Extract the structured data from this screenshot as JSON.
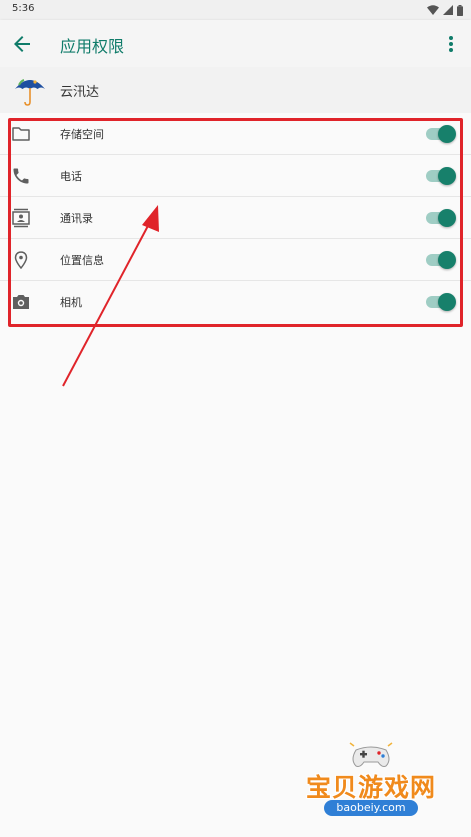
{
  "status_bar": {
    "time": "5:36"
  },
  "app_bar": {
    "title": "应用权限"
  },
  "app": {
    "name": "云汛达"
  },
  "permissions": [
    {
      "label": "存储空间",
      "icon": "folder-icon",
      "enabled": true
    },
    {
      "label": "电话",
      "icon": "phone-icon",
      "enabled": true
    },
    {
      "label": "通讯录",
      "icon": "contacts-icon",
      "enabled": true
    },
    {
      "label": "位置信息",
      "icon": "location-icon",
      "enabled": true
    },
    {
      "label": "相机",
      "icon": "camera-icon",
      "enabled": true
    }
  ],
  "watermark": {
    "title": "宝贝游戏网",
    "url": "baobeiy.com"
  },
  "colors": {
    "accent": "#107c6a",
    "toggle_thumb": "#17806b",
    "toggle_track": "#9fcdc4",
    "highlight": "#e0242a",
    "watermark_orange": "#f08a1c",
    "watermark_blue": "#2f7fd6"
  }
}
